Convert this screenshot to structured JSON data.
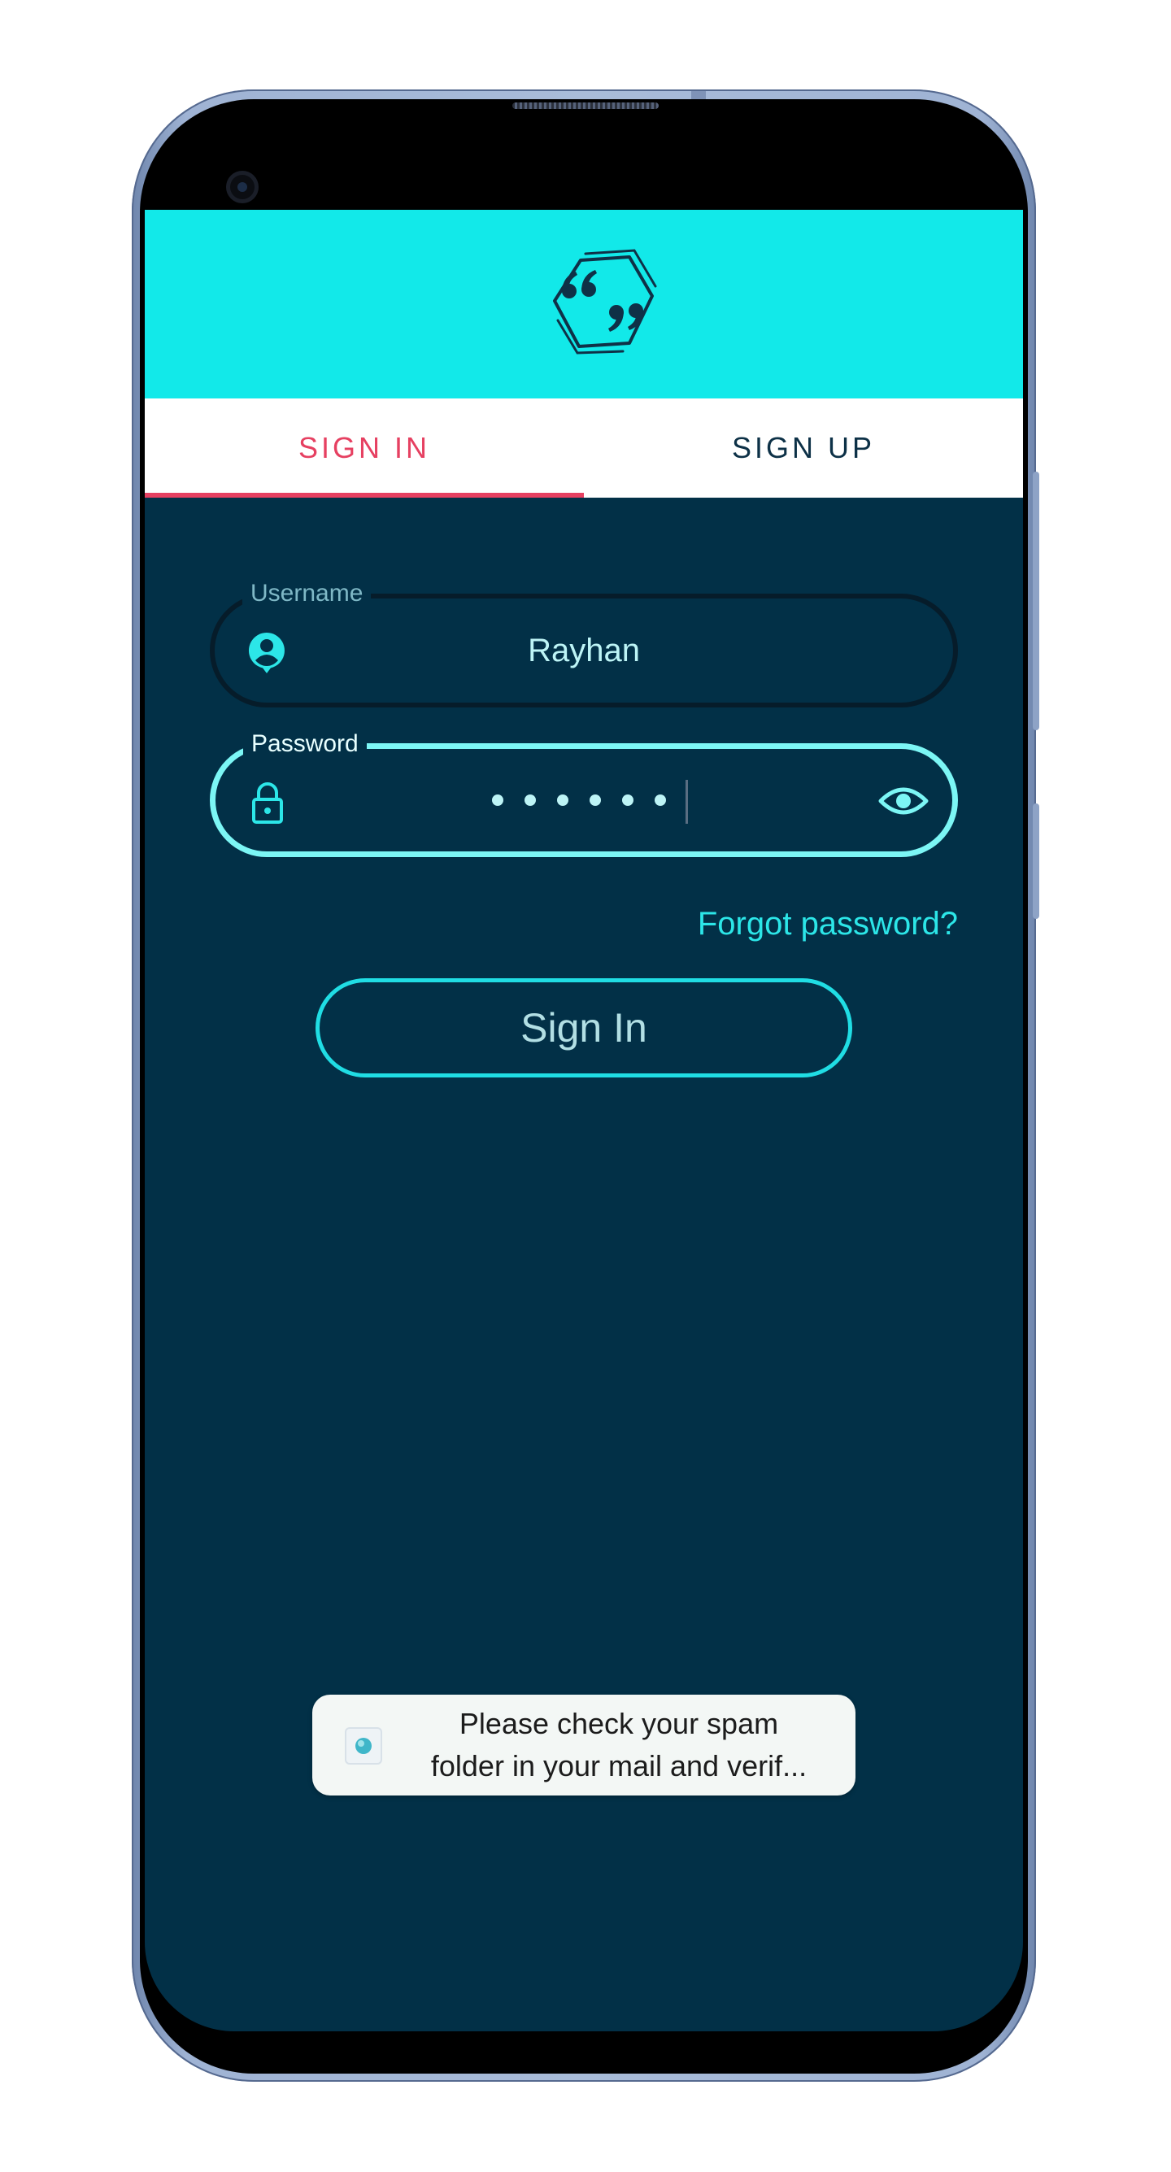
{
  "tabs": {
    "signin_label": "SIGN IN",
    "signup_label": "SIGN UP"
  },
  "form": {
    "username": {
      "label": "Username",
      "value": "Rayhan"
    },
    "password": {
      "label": "Password",
      "masked_length": 6
    },
    "forgot_password": "Forgot password?",
    "submit_label": "Sign In"
  },
  "toast": {
    "line1": "Please check your spam",
    "line2": "folder in your mail and verif..."
  },
  "colors": {
    "header": "#12e9e9",
    "background": "#023047",
    "accent": "#e64061",
    "field_active": "#7cf6f5",
    "link": "#2ce6e8"
  },
  "icons": {
    "logo": "quote-hexagon-logo",
    "username": "account-circle-icon",
    "password": "lock-icon",
    "toggle": "eye-icon"
  }
}
